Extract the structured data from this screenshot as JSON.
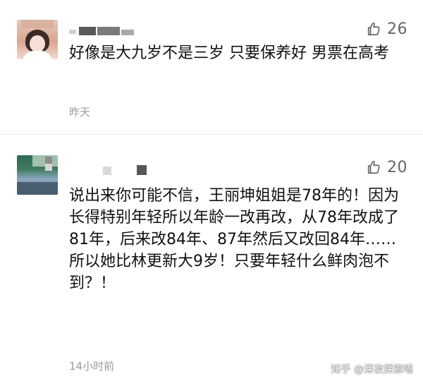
{
  "comments": [
    {
      "text": "好像是大九岁不是三岁 只要保养好 男票在高考",
      "likes": "26",
      "time": "昨天",
      "avatar_icon": "user-avatar-icon",
      "like_icon": "thumbs-up-icon"
    },
    {
      "text": "说出来你可能不信，王丽坤姐姐是78年的！因为长得特别年轻所以年龄一改再改，从78年改成了81年，后来改84年、87年然后又改回84年……所以她比林更新大9岁！只要年轻什么鲜肉泡不到？！",
      "likes": "20",
      "time": "14小时前",
      "avatar_icon": "user-avatar-icon",
      "like_icon": "thumbs-up-icon"
    }
  ],
  "watermark": "知乎 @深夜探索喵",
  "colors": {
    "text": "#111111",
    "muted": "#9a9a9a",
    "like": "#666666",
    "background": "#ffffff"
  }
}
